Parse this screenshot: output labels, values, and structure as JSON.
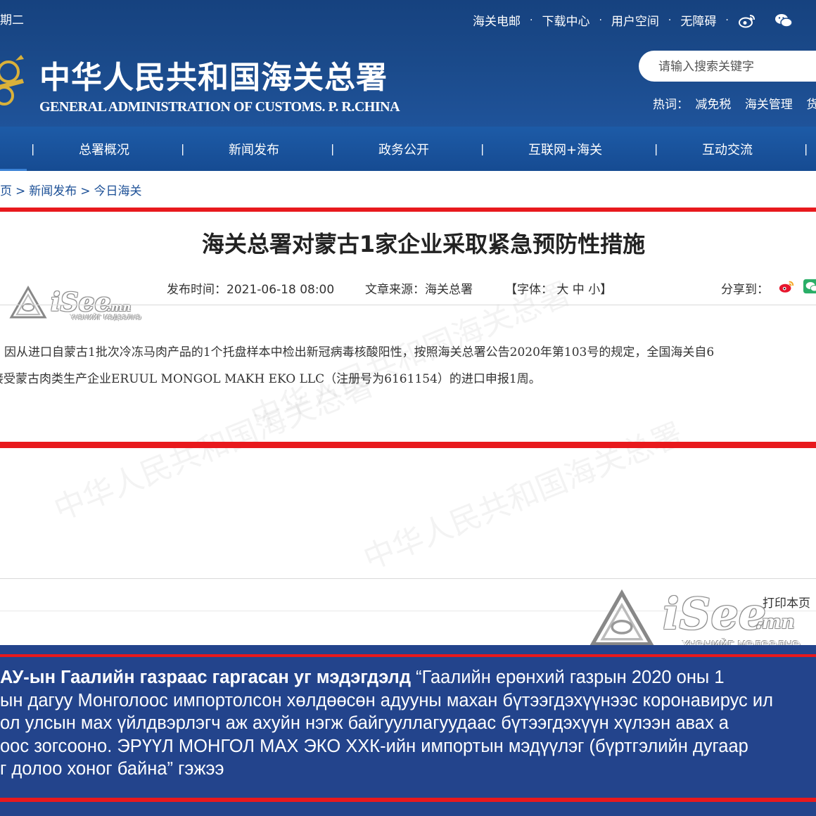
{
  "header": {
    "date_fragment": "期二",
    "top_links": [
      "海关电邮",
      "下载中心",
      "用户空间",
      "无障碍"
    ],
    "site_title_cn": "中华人民共和国海关总署",
    "site_title_en": "GENERAL ADMINISTRATION OF CUSTOMS. P. R.CHINA",
    "search_placeholder": "请输入搜索关键字",
    "hot_label": "热词：",
    "hot_words": [
      "减免税",
      "海关管理",
      "货"
    ]
  },
  "nav": {
    "items": [
      "总署概况",
      "新闻发布",
      "政务公开",
      "互联网+海关",
      "互动交流"
    ]
  },
  "breadcrumb": {
    "items": [
      "首页",
      "新闻发布",
      "今日海关"
    ],
    "separator": ">"
  },
  "article": {
    "title": "海关总署对蒙古1家企业采取紧急预防性措施",
    "publish_time": "发布时间：2021-06-18 08:00",
    "source": "文章来源：海关总署",
    "font_size": "【字体：  大  中  小】",
    "share_label": "分享到：",
    "paragraph_line1": "因从进口自蒙古1批次冷冻马肉产品的1个托盘样本中检出新冠病毒核酸阳性，按照海关总署公告2020年第103号的规定，全国海关自6",
    "paragraph_line2": "接受蒙古肉类生产企业ERUUL MONGOL MAKH EKO LLC（注册号为6161154）的进口申报1周。",
    "print_label": "打印本页"
  },
  "watermark": {
    "brand": "iSee",
    "domain": ".mn",
    "tagline": "ҮНЭНИЙГ МЭДЭЭЛНЭ"
  },
  "caption": {
    "bold_lead": "АУ-ын Гаалийн газраас гаргасан уг мэдэгдэлд",
    "line1_rest": " “Гаалийн ерөнхий газрын 2020 оны 1",
    "line2": "ын дагуу Монголоос импортолсон хөлдөөсөн адууны махан бүтээгдэхүүнээс коронавирус ил",
    "line3": "ол улсын мах үйлдвэрлэгч аж ахуйн нэгж байгууллагуудаас бүтээгдэхүүн хүлээн авах а",
    "line4": "оос зогсооно. ЭРҮҮЛ МОНГОЛ МАХ ЭКО ХХК-ийн импортын мэдүүлэг (бүртгэлийн дугаар",
    "line5": "г долоо хоног байна” гэжээ"
  },
  "colors": {
    "header_blue": "#1b4b8c",
    "nav_blue": "#1d5ba7",
    "accent_red": "#e8191d",
    "caption_blue": "#23448c"
  }
}
